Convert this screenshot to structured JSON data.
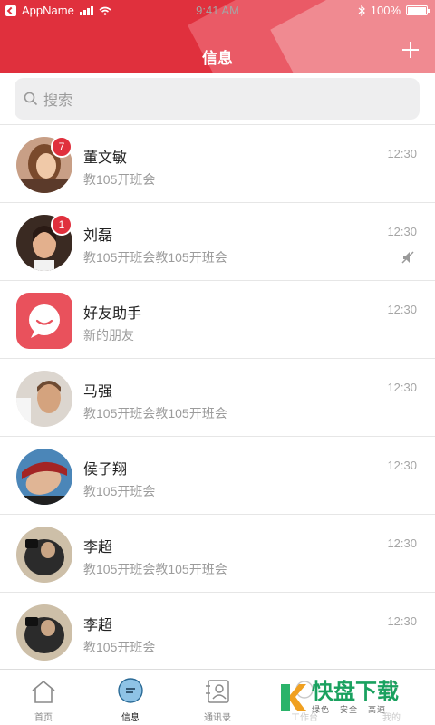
{
  "status": {
    "carrier": "AppName",
    "time": "9:41 AM",
    "battery": "100%"
  },
  "header": {
    "title": "信息"
  },
  "search": {
    "placeholder": "搜索"
  },
  "rows": [
    {
      "name": "董文敏",
      "sub": "教105开班会",
      "time": "12:30",
      "badge": "7"
    },
    {
      "name": "刘磊",
      "sub": "教105开班会教105开班会",
      "time": "12:30",
      "badge": "1"
    },
    {
      "name": "好友助手",
      "sub": "新的朋友",
      "time": "12:30"
    },
    {
      "name": "马强",
      "sub": "教105开班会教105开班会",
      "time": "12:30"
    },
    {
      "name": "侯子翔",
      "sub": "教105开班会",
      "time": "12:30"
    },
    {
      "name": "李超",
      "sub": "教105开班会教105开班会",
      "time": "12:30"
    },
    {
      "name": "李超",
      "sub": "教105开班会",
      "time": "12:30"
    }
  ],
  "tabs": [
    {
      "label": "首页"
    },
    {
      "label": "信息"
    },
    {
      "label": "通讯录"
    },
    {
      "label": "工作台"
    },
    {
      "label": "我的"
    }
  ],
  "watermark": {
    "title": "快盘下载",
    "tagline": "绿色 · 安全 · 高速"
  },
  "colors": {
    "accent": "#e0303d",
    "helper": "#e9515c"
  }
}
